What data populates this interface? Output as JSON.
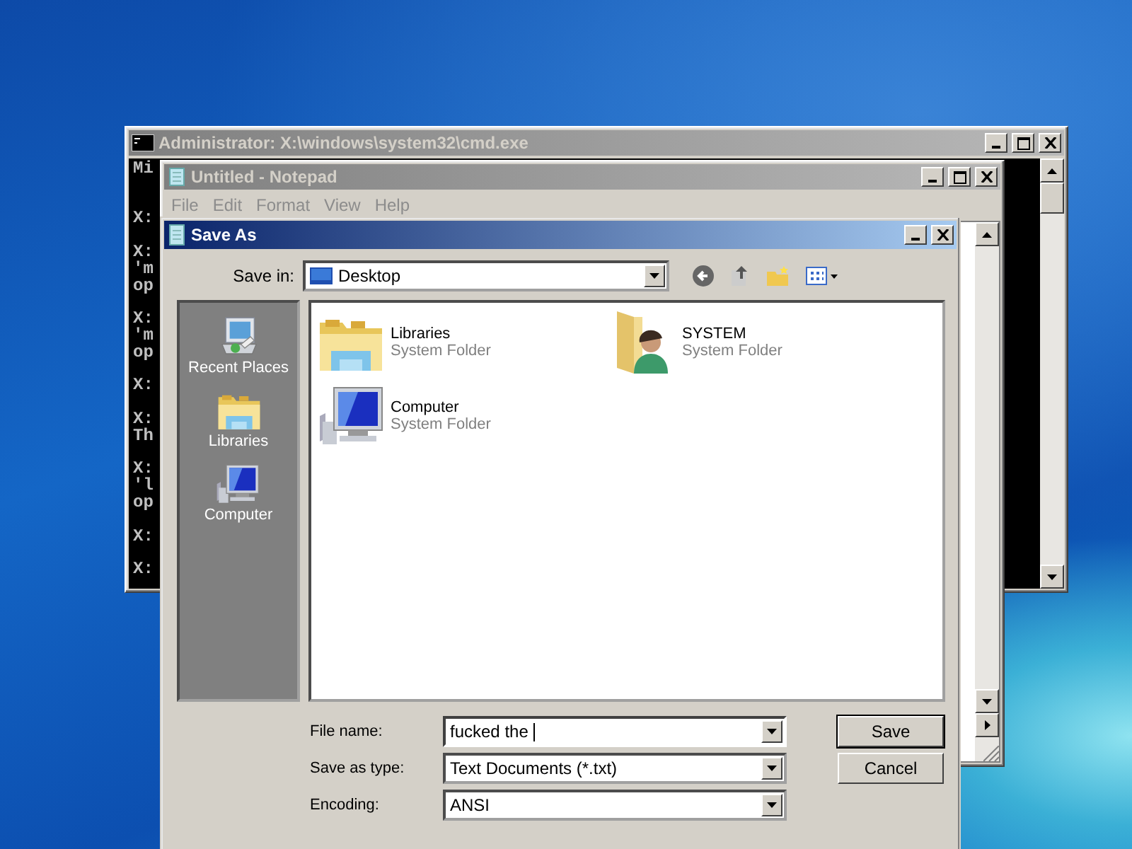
{
  "console_window": {
    "title": "Administrator: X:\\windows\\system32\\cmd.exe",
    "active": false,
    "blocks": [
      {
        "lines": [
          "Mi"
        ]
      },
      {
        "lines": [
          "X:"
        ]
      },
      {
        "lines": [
          "X:",
          "'m",
          "op"
        ]
      },
      {
        "lines": [
          "X:",
          "'m",
          "op"
        ]
      },
      {
        "lines": [
          "X:"
        ]
      },
      {
        "lines": [
          "X:",
          "Th"
        ]
      },
      {
        "lines": [
          "X:",
          "'l",
          "op"
        ]
      },
      {
        "lines": [
          "X:"
        ]
      },
      {
        "lines": [
          "X:"
        ]
      }
    ]
  },
  "notepad_window": {
    "title": "Untitled - Notepad",
    "active": false,
    "menu": [
      {
        "label": "File",
        "disabled": true
      },
      {
        "label": "Edit",
        "disabled": true
      },
      {
        "label": "Format",
        "disabled": true
      },
      {
        "label": "View",
        "disabled": true
      },
      {
        "label": "Help",
        "disabled": true
      }
    ]
  },
  "save_dialog": {
    "title": "Save As",
    "active": true,
    "save_in": {
      "label": "Save in:",
      "value": "Desktop"
    },
    "places": [
      {
        "label": "Recent Places",
        "kind": "recent"
      },
      {
        "label": "Libraries",
        "kind": "libraries"
      },
      {
        "label": "Computer",
        "kind": "computer"
      }
    ],
    "items": [
      {
        "name": "Libraries",
        "type": "System Folder",
        "kind": "libraries"
      },
      {
        "name": "SYSTEM",
        "type": "System Folder",
        "kind": "user"
      },
      {
        "name": "Computer",
        "type": "System Folder",
        "kind": "computer"
      }
    ],
    "fields": [
      {
        "label": "File name:",
        "value": "fucked the ",
        "focused": true
      },
      {
        "label": "Save as type:",
        "value": "Text Documents (*.txt)",
        "focused": false
      },
      {
        "label": "Encoding:",
        "value": "ANSI",
        "focused": false
      }
    ],
    "buttons": [
      {
        "label": "Save",
        "default": true
      },
      {
        "label": "Cancel",
        "default": false
      }
    ]
  }
}
